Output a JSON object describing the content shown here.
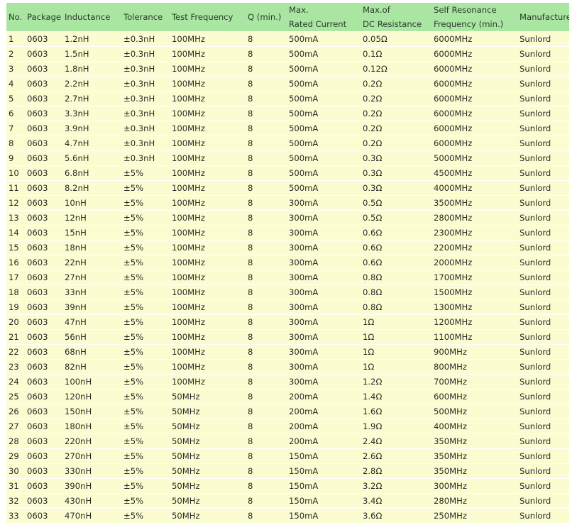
{
  "table": {
    "headers": {
      "no": "No.",
      "package": "Package",
      "inductance": "Inductance",
      "tolerance": "Tolerance",
      "test_frequency": "Test Frequency",
      "q_min": "Q (min.)",
      "max_rated_current_line1": "Max.",
      "max_rated_current_line2": "Rated Current",
      "max_dc_resistance_line1": "Max.of",
      "max_dc_resistance_line2": "DC Resistance",
      "self_resonance_line1": "Self Resonance",
      "self_resonance_line2": "Frequency (min.)",
      "manufacturer": "Manufacture"
    },
    "rows": [
      [
        "1",
        "0603",
        "1.2nH",
        "±0.3nH",
        "100MHz",
        "8",
        "500mA",
        "0.05Ω",
        "6000MHz",
        "Sunlord"
      ],
      [
        "2",
        "0603",
        "1.5nH",
        "±0.3nH",
        "100MHz",
        "8",
        "500mA",
        "0.1Ω",
        "6000MHz",
        "Sunlord"
      ],
      [
        "3",
        "0603",
        "1.8nH",
        "±0.3nH",
        "100MHz",
        "8",
        "500mA",
        "0.12Ω",
        "6000MHz",
        "Sunlord"
      ],
      [
        "4",
        "0603",
        "2.2nH",
        "±0.3nH",
        "100MHz",
        "8",
        "500mA",
        "0.2Ω",
        "6000MHz",
        "Sunlord"
      ],
      [
        "5",
        "0603",
        "2.7nH",
        "±0.3nH",
        "100MHz",
        "8",
        "500mA",
        "0.2Ω",
        "6000MHz",
        "Sunlord"
      ],
      [
        "6",
        "0603",
        "3.3nH",
        "±0.3nH",
        "100MHz",
        "8",
        "500mA",
        "0.2Ω",
        "6000MHz",
        "Sunlord"
      ],
      [
        "7",
        "0603",
        "3.9nH",
        "±0.3nH",
        "100MHz",
        "8",
        "500mA",
        "0.2Ω",
        "6000MHz",
        "Sunlord"
      ],
      [
        "8",
        "0603",
        "4.7nH",
        "±0.3nH",
        "100MHz",
        "8",
        "500mA",
        "0.2Ω",
        "6000MHz",
        "Sunlord"
      ],
      [
        "9",
        "0603",
        "5.6nH",
        "±0.3nH",
        "100MHz",
        "8",
        "500mA",
        "0.3Ω",
        "5000MHz",
        "Sunlord"
      ],
      [
        "10",
        "0603",
        "6.8nH",
        "±5%",
        "100MHz",
        "8",
        "500mA",
        "0.3Ω",
        "4500MHz",
        "Sunlord"
      ],
      [
        "11",
        "0603",
        "8.2nH",
        "±5%",
        "100MHz",
        "8",
        "500mA",
        "0.3Ω",
        "4000MHz",
        "Sunlord"
      ],
      [
        "12",
        "0603",
        "10nH",
        "±5%",
        "100MHz",
        "8",
        "300mA",
        "0.5Ω",
        "3500MHz",
        "Sunlord"
      ],
      [
        "13",
        "0603",
        "12nH",
        "±5%",
        "100MHz",
        "8",
        "300mA",
        "0.5Ω",
        "2800MHz",
        "Sunlord"
      ],
      [
        "14",
        "0603",
        "15nH",
        "±5%",
        "100MHz",
        "8",
        "300mA",
        "0.6Ω",
        "2300MHz",
        "Sunlord"
      ],
      [
        "15",
        "0603",
        "18nH",
        "±5%",
        "100MHz",
        "8",
        "300mA",
        "0.6Ω",
        "2200MHz",
        "Sunlord"
      ],
      [
        "16",
        "0603",
        "22nH",
        "±5%",
        "100MHz",
        "8",
        "300mA",
        "0.6Ω",
        "2000MHz",
        "Sunlord"
      ],
      [
        "17",
        "0603",
        "27nH",
        "±5%",
        "100MHz",
        "8",
        "300mA",
        "0.8Ω",
        "1700MHz",
        "Sunlord"
      ],
      [
        "18",
        "0603",
        "33nH",
        "±5%",
        "100MHz",
        "8",
        "300mA",
        "0.8Ω",
        "1500MHz",
        "Sunlord"
      ],
      [
        "19",
        "0603",
        "39nH",
        "±5%",
        "100MHz",
        "8",
        "300mA",
        "0.8Ω",
        "1300MHz",
        "Sunlord"
      ],
      [
        "20",
        "0603",
        "47nH",
        "±5%",
        "100MHz",
        "8",
        "300mA",
        "1Ω",
        "1200MHz",
        "Sunlord"
      ],
      [
        "21",
        "0603",
        "56nH",
        "±5%",
        "100MHz",
        "8",
        "300mA",
        "1Ω",
        "1100MHz",
        "Sunlord"
      ],
      [
        "22",
        "0603",
        "68nH",
        "±5%",
        "100MHz",
        "8",
        "300mA",
        "1Ω",
        "900MHz",
        "Sunlord"
      ],
      [
        "23",
        "0603",
        "82nH",
        "±5%",
        "100MHz",
        "8",
        "300mA",
        "1Ω",
        "800MHz",
        "Sunlord"
      ],
      [
        "24",
        "0603",
        "100nH",
        "±5%",
        "100MHz",
        "8",
        "300mA",
        "1.2Ω",
        "700MHz",
        "Sunlord"
      ],
      [
        "25",
        "0603",
        "120nH",
        "±5%",
        "50MHz",
        "8",
        "200mA",
        "1.4Ω",
        "600MHz",
        "Sunlord"
      ],
      [
        "26",
        "0603",
        "150nH",
        "±5%",
        "50MHz",
        "8",
        "200mA",
        "1.6Ω",
        "500MHz",
        "Sunlord"
      ],
      [
        "27",
        "0603",
        "180nH",
        "±5%",
        "50MHz",
        "8",
        "200mA",
        "1.9Ω",
        "400MHz",
        "Sunlord"
      ],
      [
        "28",
        "0603",
        "220nH",
        "±5%",
        "50MHz",
        "8",
        "200mA",
        "2.4Ω",
        "350MHz",
        "Sunlord"
      ],
      [
        "29",
        "0603",
        "270nH",
        "±5%",
        "50MHz",
        "8",
        "150mA",
        "2.6Ω",
        "350MHz",
        "Sunlord"
      ],
      [
        "30",
        "0603",
        "330nH",
        "±5%",
        "50MHz",
        "8",
        "150mA",
        "2.8Ω",
        "350MHz",
        "Sunlord"
      ],
      [
        "31",
        "0603",
        "390nH",
        "±5%",
        "50MHz",
        "8",
        "150mA",
        "3.2Ω",
        "300MHz",
        "Sunlord"
      ],
      [
        "32",
        "0603",
        "430nH",
        "±5%",
        "50MHz",
        "8",
        "150mA",
        "3.4Ω",
        "280MHz",
        "Sunlord"
      ],
      [
        "33",
        "0603",
        "470nH",
        "±5%",
        "50MHz",
        "8",
        "150mA",
        "3.6Ω",
        "250MHz",
        "Sunlord"
      ]
    ]
  }
}
